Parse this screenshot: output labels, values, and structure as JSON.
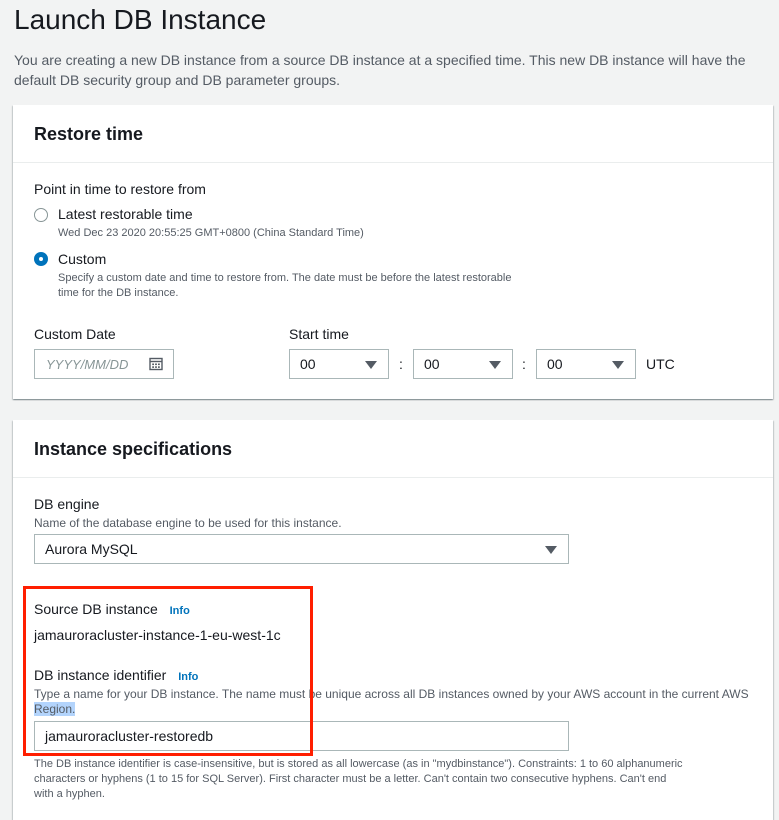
{
  "page": {
    "title": "Launch DB Instance",
    "description": "You are creating a new DB instance from a source DB instance at a specified time. This new DB instance will have the default DB security group and DB parameter groups."
  },
  "restore_time": {
    "header": "Restore time",
    "point_label": "Point in time to restore from",
    "option_latest": {
      "label": "Latest restorable time",
      "desc": "Wed Dec 23 2020 20:55:25 GMT+0800 (China Standard Time)",
      "selected": false
    },
    "option_custom": {
      "label": "Custom",
      "desc_line1": "Specify a custom date and time to restore from. The date must be before the latest restorable",
      "desc_line2": "time for the DB instance.",
      "selected": true
    },
    "custom_date_label": "Custom Date",
    "custom_date_placeholder": "YYYY/MM/DD",
    "start_time_label": "Start time",
    "hour": "00",
    "minute": "00",
    "second": "00",
    "separator": ":",
    "timezone": "UTC"
  },
  "instance_specs": {
    "header": "Instance specifications",
    "engine_label": "DB engine",
    "engine_desc": "Name of the database engine to be used for this instance.",
    "engine_value": "Aurora MySQL",
    "source_label": "Source DB instance",
    "info_text": "Info",
    "source_value": "jamauroracluster-instance-1-eu-west-1c",
    "identifier_label": "DB instance identifier",
    "identifier_desc_line1": "Type a name for your DB instance. The name must be unique across all DB instances owned by your AWS account in the current AWS",
    "identifier_desc_line2": "Region.",
    "identifier_value": "jamauroracluster-restoredb",
    "constraints_line1": "The DB instance identifier is case-insensitive, but is stored as all lowercase (as in \"mydbinstance\"). Constraints: 1 to 60 alphanumeric",
    "constraints_line2": "characters or hyphens (1 to 15 for SQL Server). First character must be a letter. Can't contain two consecutive hyphens. Can't end",
    "constraints_line3": "with a hyphen."
  },
  "colors": {
    "accent": "#0073bb",
    "highlight_border": "#ff1e00",
    "background": "#f2f3f3"
  },
  "icons": [
    "calendar-icon",
    "caret-down-icon"
  ]
}
